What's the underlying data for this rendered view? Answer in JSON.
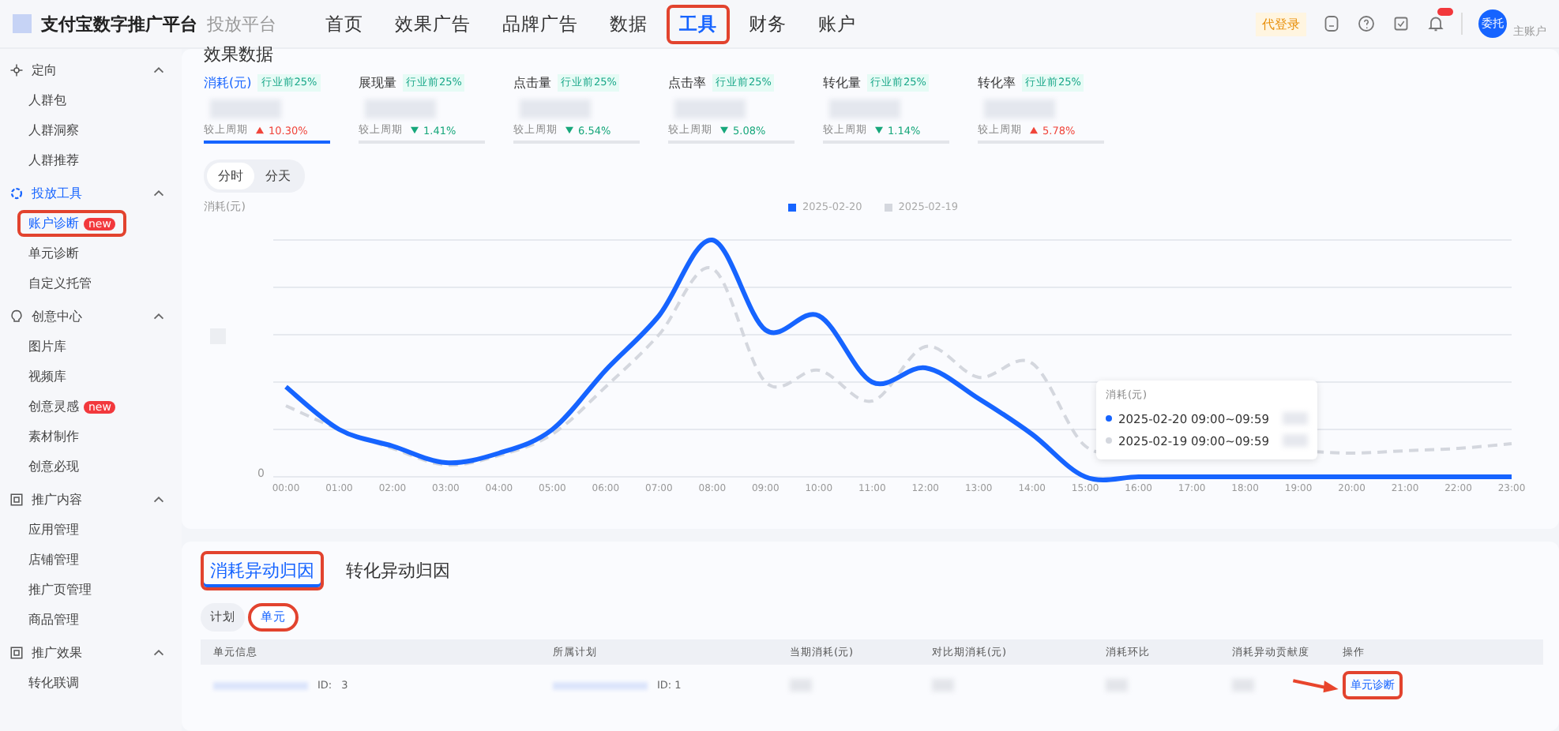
{
  "header": {
    "brand": "支付宝数字推广平台",
    "product": "投放平台",
    "nav": [
      {
        "label": "首页",
        "selected": false,
        "annotated": false
      },
      {
        "label": "效果广告",
        "selected": false,
        "annotated": false
      },
      {
        "label": "品牌广告",
        "selected": false,
        "annotated": false
      },
      {
        "label": "数据",
        "selected": false,
        "annotated": false
      },
      {
        "label": "工具",
        "selected": true,
        "annotated": true
      },
      {
        "label": "财务",
        "selected": false,
        "annotated": false
      },
      {
        "label": "账户",
        "selected": false,
        "annotated": false
      }
    ],
    "proxy_badge": "代登录",
    "avatar": "委托",
    "account_role": "主账户"
  },
  "sidebar": [
    {
      "title": "定向",
      "expanded": true,
      "items": [
        {
          "label": "人群包",
          "selected": false,
          "annotated": false
        },
        {
          "label": "人群洞察",
          "selected": false,
          "annotated": false
        },
        {
          "label": "人群推荐",
          "selected": false,
          "annotated": false
        }
      ]
    },
    {
      "title": "投放工具",
      "expanded": true,
      "items": [
        {
          "label": "账户诊断",
          "selected": true,
          "annotated": true,
          "new_badge": "new"
        },
        {
          "label": "单元诊断",
          "selected": false,
          "annotated": false
        },
        {
          "label": "自定义托管",
          "selected": false,
          "annotated": false
        }
      ]
    },
    {
      "title": "创意中心",
      "expanded": true,
      "items": [
        {
          "label": "图片库",
          "selected": false,
          "annotated": false
        },
        {
          "label": "视频库",
          "selected": false,
          "annotated": false
        },
        {
          "label": "创意灵感",
          "selected": false,
          "annotated": false,
          "new_badge": "new"
        },
        {
          "label": "素材制作",
          "selected": false,
          "annotated": false
        },
        {
          "label": "创意必现",
          "selected": false,
          "annotated": false
        }
      ]
    },
    {
      "title": "推广内容",
      "expanded": true,
      "items": [
        {
          "label": "应用管理",
          "selected": false,
          "annotated": false
        },
        {
          "label": "店铺管理",
          "selected": false,
          "annotated": false
        },
        {
          "label": "推广页管理",
          "selected": false,
          "annotated": false
        },
        {
          "label": "商品管理",
          "selected": false,
          "annotated": false
        }
      ]
    },
    {
      "title": "推广效果",
      "expanded": true,
      "items": [
        {
          "label": "转化联调",
          "selected": false,
          "annotated": false
        }
      ]
    }
  ],
  "effect_card": {
    "title": "效果数据",
    "metrics": [
      {
        "label": "消耗(元)",
        "badge": "行业前25%",
        "selected": true,
        "compare_label": "较上周期",
        "change": "10.30%",
        "increase": true
      },
      {
        "label": "展现量",
        "badge": "行业前25%",
        "selected": false,
        "compare_label": "较上周期",
        "change": "1.41%",
        "increase": false
      },
      {
        "label": "点击量",
        "badge": "行业前25%",
        "selected": false,
        "compare_label": "较上周期",
        "change": "6.54%",
        "increase": false
      },
      {
        "label": "点击率",
        "badge": "行业前25%",
        "selected": false,
        "compare_label": "较上周期",
        "change": "5.08%",
        "increase": false
      },
      {
        "label": "转化量",
        "badge": "行业前25%",
        "selected": false,
        "compare_label": "较上周期",
        "change": "1.14%",
        "increase": false
      },
      {
        "label": "转化率",
        "badge": "行业前25%",
        "selected": false,
        "compare_label": "较上周期",
        "change": "5.78%",
        "increase": true
      }
    ],
    "granularity": [
      {
        "label": "分时",
        "selected": true
      },
      {
        "label": "分天",
        "selected": false
      }
    ],
    "chart": {
      "y_label": "消耗(元)",
      "y_zero": "0",
      "legend": [
        {
          "label": "2025-02-20",
          "color": "#1664ff"
        },
        {
          "label": "2025-02-19",
          "color": "#d4d7de"
        }
      ],
      "x_labels": [
        "00:00",
        "01:00",
        "02:00",
        "03:00",
        "04:00",
        "05:00",
        "06:00",
        "07:00",
        "08:00",
        "09:00",
        "10:00",
        "11:00",
        "12:00",
        "13:00",
        "14:00",
        "15:00",
        "16:00",
        "17:00",
        "18:00",
        "19:00",
        "20:00",
        "21:00",
        "22:00",
        "23:00"
      ],
      "tooltip": {
        "title": "消耗(元)",
        "rows": [
          {
            "label": "2025-02-20 09:00~09:59",
            "color": "#1664ff"
          },
          {
            "label": "2025-02-19 09:00~09:59",
            "color": "#d4d7de"
          }
        ]
      }
    }
  },
  "attribution_card": {
    "tabs": [
      {
        "label": "消耗异动归因",
        "selected": true,
        "annotated": true
      },
      {
        "label": "转化异动归因",
        "selected": false,
        "annotated": false
      }
    ],
    "levels": [
      {
        "label": "计划",
        "selected": false,
        "annotated": false
      },
      {
        "label": "单元",
        "selected": true,
        "annotated": true
      }
    ],
    "columns": [
      "单元信息",
      "所属计划",
      "当期消耗(元)",
      "对比期消耗(元)",
      "消耗环比",
      "消耗异动贡献度",
      "操作"
    ],
    "rows": [
      {
        "unit_id_label": "ID:",
        "unit_id_tail": "3",
        "plan_id": "ID: 1",
        "action": "单元诊断",
        "action_annotated": true
      }
    ]
  }
}
